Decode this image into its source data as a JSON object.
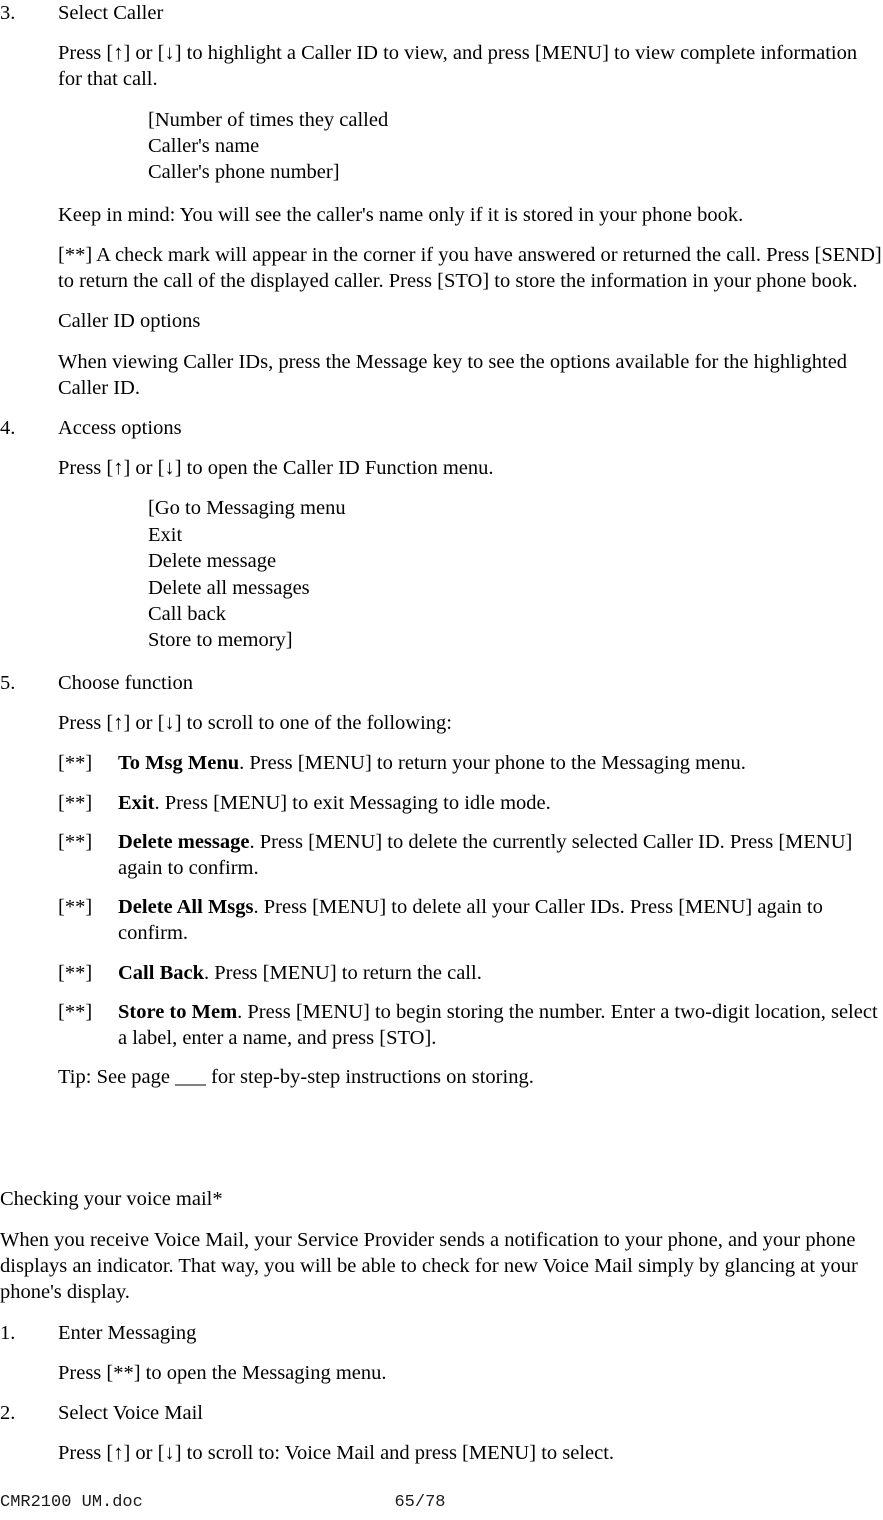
{
  "document": {
    "footer_doc_name": "CMR2100 UM.doc",
    "footer_page": "65/78"
  },
  "steps": {
    "step3": {
      "number": "3.",
      "title": "Select Caller",
      "instruction": "Press [↑] or [↓] to highlight a Caller ID to view, and press [MENU] to view complete information for that call.",
      "display_listing": [
        "[Number of times they called",
        "Caller's name",
        "Caller's phone number]"
      ],
      "keep_in_mind": "Keep in mind:  You will see the caller's name only if it is stored in your phone book.",
      "checkmark_note": "[**] A check mark will appear in the corner if you have answered or returned the call. Press [SEND] to return the call of the displayed caller. Press [STO] to store the information in your phone book.",
      "options_heading": "Caller ID options",
      "options_text": "When viewing Caller IDs, press the Message key to see the options available for the highlighted Caller ID."
    },
    "step4": {
      "number": "4.",
      "title": "Access options",
      "instruction": "Press [↑] or [↓] to open the Caller ID Function menu.",
      "menu_listing": [
        "[Go to Messaging menu",
        "Exit",
        "Delete message",
        "Delete all messages",
        "Call back",
        "Store to memory]"
      ]
    },
    "step5": {
      "number": "5.",
      "title": "Choose function",
      "instruction": "Press [↑] or [↓] to scroll to one of the following:",
      "functions": [
        {
          "mark": "[**]",
          "label": "To Msg Menu",
          "description": ". Press [MENU] to return your phone to the Messaging menu."
        },
        {
          "mark": "[**]",
          "label": "Exit",
          "description": ". Press [MENU] to exit Messaging to idle mode."
        },
        {
          "mark": "[**]",
          "label": "Delete message",
          "description": ". Press [MENU] to delete the currently selected Caller ID. Press [MENU] again to confirm."
        },
        {
          "mark": "[**]",
          "label": "Delete All Msgs",
          "description": ". Press [MENU] to delete all your Caller IDs. Press [MENU] again to confirm."
        },
        {
          "mark": "[**]",
          "label": "Call Back",
          "description": ". Press [MENU] to return the call."
        },
        {
          "mark": "[**]",
          "label": "Store to Mem",
          "description": ". Press [MENU] to begin storing the number. Enter a two-digit location, select a label, enter a name, and press [STO]."
        }
      ],
      "tip": "Tip:  See page ___ for step-by-step instructions on storing."
    }
  },
  "voicemail_section": {
    "heading": "Checking your voice mail*",
    "intro": "When you receive Voice Mail, your Service Provider sends a notification to your phone, and your phone displays an indicator. That way, you will be able to check for new Voice Mail simply by glancing at your phone's display.",
    "step1": {
      "number": "1.",
      "title": "Enter Messaging",
      "instruction": "Press [**] to open the Messaging menu."
    },
    "step2": {
      "number": "2.",
      "title": "Select Voice Mail",
      "instruction": "Press [↑] or [↓] to scroll to: Voice Mail and press [MENU] to select."
    }
  }
}
